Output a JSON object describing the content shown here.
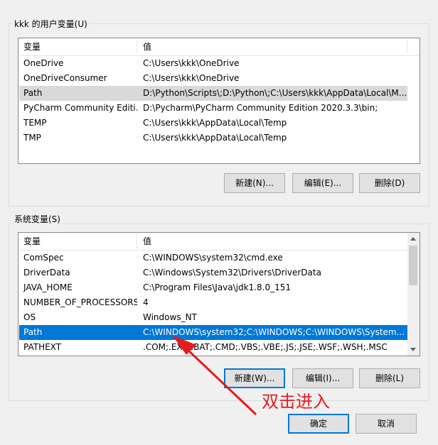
{
  "user_vars": {
    "group_label": "kkk 的用户变量(U)",
    "col_var": "变量",
    "col_val": "值",
    "rows": [
      {
        "name": "OneDrive",
        "value": "C:\\Users\\kkk\\OneDrive"
      },
      {
        "name": "OneDriveConsumer",
        "value": "C:\\Users\\kkk\\OneDrive"
      },
      {
        "name": "Path",
        "value": "D:\\Python\\Scripts\\;D:\\Python\\;C:\\Users\\kkk\\AppData\\Local\\M..."
      },
      {
        "name": "PyCharm Community Editi...",
        "value": "D:\\Pycharm\\PyCharm Community Edition 2020.3.3\\bin;"
      },
      {
        "name": "TEMP",
        "value": "C:\\Users\\kkk\\AppData\\Local\\Temp"
      },
      {
        "name": "TMP",
        "value": "C:\\Users\\kkk\\AppData\\Local\\Temp"
      }
    ],
    "new_label": "新建(N)...",
    "edit_label": "编辑(E)...",
    "delete_label": "删除(D)"
  },
  "sys_vars": {
    "group_label": "系统变量(S)",
    "col_var": "变量",
    "col_val": "值",
    "rows": [
      {
        "name": "ComSpec",
        "value": "C:\\WINDOWS\\system32\\cmd.exe"
      },
      {
        "name": "DriverData",
        "value": "C:\\Windows\\System32\\Drivers\\DriverData"
      },
      {
        "name": "JAVA_HOME",
        "value": "C:\\Program Files\\Java\\jdk1.8.0_151"
      },
      {
        "name": "NUMBER_OF_PROCESSORS",
        "value": "4"
      },
      {
        "name": "OS",
        "value": "Windows_NT"
      },
      {
        "name": "Path",
        "value": "C:\\WINDOWS\\system32;C:\\WINDOWS;C:\\WINDOWS\\System..."
      },
      {
        "name": "PATHEXT",
        "value": ".COM;.EXE;.BAT;.CMD;.VBS;.VBE;.JS;.JSE;.WSF;.WSH;.MSC"
      }
    ],
    "new_label": "新建(W)...",
    "edit_label": "编辑(I)...",
    "delete_label": "删除(L)"
  },
  "annotation": "双击进入",
  "ok_label": "确定",
  "cancel_label": "取消",
  "colors": {
    "selection": "#0078d7",
    "annotation": "#e31c1c"
  }
}
